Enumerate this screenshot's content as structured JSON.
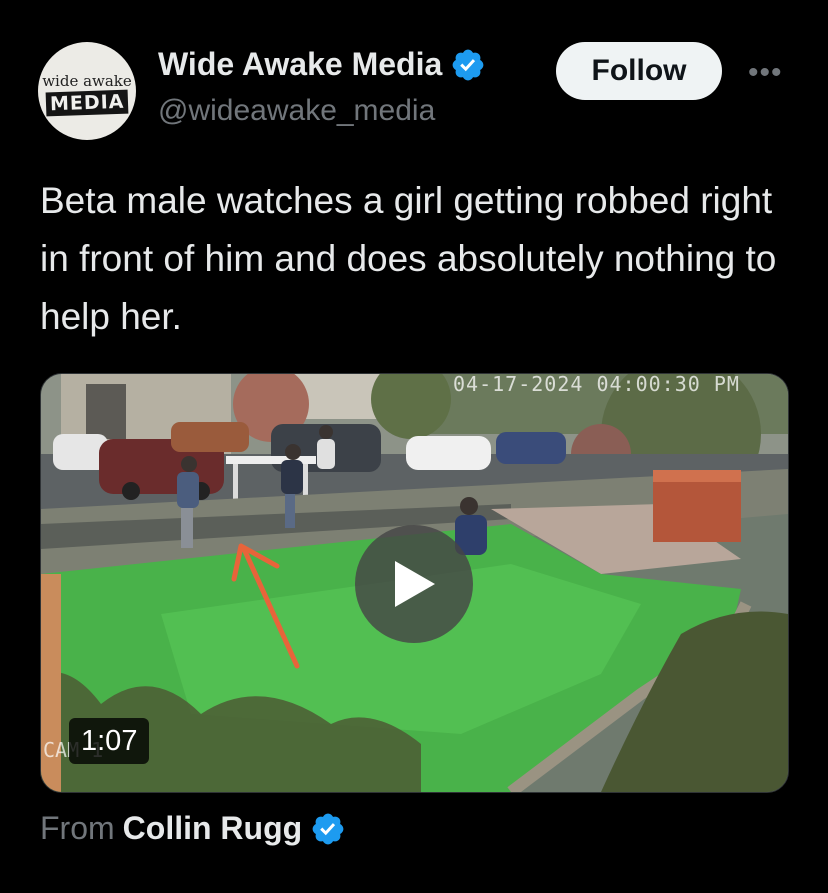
{
  "author": {
    "display_name": "Wide Awake Media",
    "handle": "@wideawake_media",
    "avatar_text_top": "wide awake",
    "avatar_text_bottom": "MEDIA",
    "verified_icon": "verified-badge-icon"
  },
  "actions": {
    "follow_label": "Follow",
    "more_label": "•••"
  },
  "tweet": {
    "text": "Beta male watches a girl getting robbed right in front of him and does absolutely nothing to help her."
  },
  "media": {
    "timestamp": "04-17-2024 04:00:30 PM",
    "camera_label": "CAM 1",
    "duration": "1:07",
    "play_icon": "play-icon"
  },
  "source": {
    "from_label": "From",
    "author": "Collin Rugg",
    "verified_icon": "verified-badge-icon"
  },
  "colors": {
    "background": "#000000",
    "text_primary": "#e7e9ea",
    "text_secondary": "#71767b",
    "verified": "#1d9bf0",
    "follow_bg": "#eff3f4",
    "arrow": "#e8643a"
  }
}
